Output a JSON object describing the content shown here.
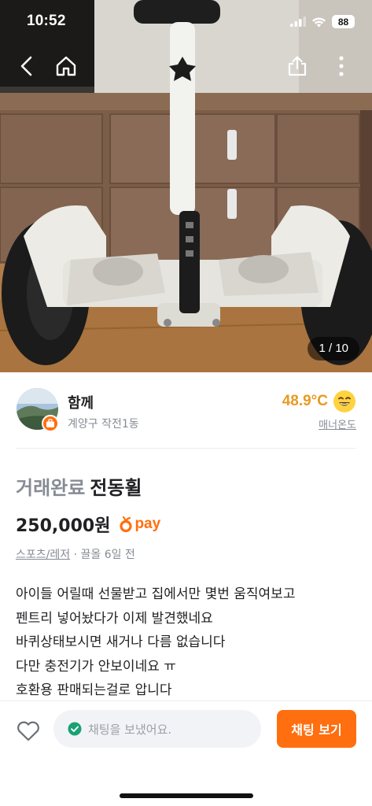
{
  "status_bar": {
    "time": "10:52",
    "battery": "88"
  },
  "nav": {
    "back_icon": "chevron-left-icon",
    "home_icon": "home-icon",
    "share_icon": "share-icon",
    "more_icon": "more-vertical-icon"
  },
  "photo": {
    "counter": "1 / 10"
  },
  "seller": {
    "name": "함께",
    "location": "계양구 작전1동",
    "manner_temp": "48.9°C",
    "manner_label": "매너온도",
    "emoji": "smiling-face-icon"
  },
  "listing": {
    "status": "거래완료",
    "title": "전동휠",
    "price": "250,000원",
    "pay_label": "pay",
    "category": "스포츠/레저",
    "bump_time": "끌올 6일 전",
    "description_lines": [
      "아이들 어릴때 선물받고 집에서만 몇번 움직여보고",
      "펜트리 넣어놨다가 이제 발견했네요",
      "바퀴상태보시면 새거나 다름 없습니다",
      "다만 충전기가 안보이네요 ㅠ",
      "호환용 판매되는걸로 압니다"
    ]
  },
  "bottom_bar": {
    "chat_placeholder": "채팅을 보냈어요.",
    "chat_button": "채팅 보기"
  },
  "colors": {
    "accent": "#ff6f0f",
    "manner": "#e79b22",
    "muted": "#868b94"
  }
}
